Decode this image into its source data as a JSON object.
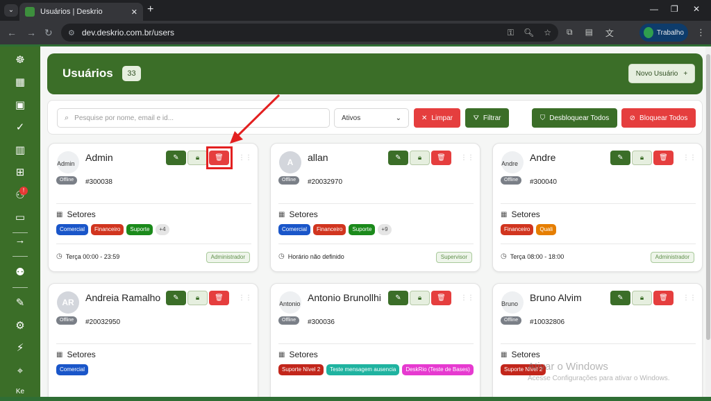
{
  "browser": {
    "tab_title": "Usuários | Deskrio",
    "url": "dev.deskrio.com.br/users",
    "profile_label": "Trabalho"
  },
  "sidebar": {
    "notification_badge": "!",
    "bottom_label": "Ke"
  },
  "header": {
    "title": "Usuários",
    "count": "33",
    "new_user_label": "Novo Usuário"
  },
  "filters": {
    "search_placeholder": "Pesquise por nome, email e id...",
    "status_value": "Ativos",
    "clear_label": "Limpar",
    "filter_label": "Filtrar",
    "unlock_all_label": "Desbloquear Todos",
    "lock_all_label": "Bloquear Todos"
  },
  "labels": {
    "offline": "Offline",
    "setores": "Setores"
  },
  "colors": {
    "primary_green": "#3b6e28",
    "danger_red": "#e53e3e",
    "comercial": "#1a56c9",
    "financeiro": "#d1351f",
    "suporte": "#1b8a1b",
    "quali": "#e67e00",
    "suporte_nivel2": "#c2261b",
    "teste_msg": "#1fb3a0",
    "deskrio_bases": "#e63ad0"
  },
  "cards": [
    {
      "name": "Admin",
      "avatar": "Admin",
      "avatar_type": "image",
      "id": "#300038",
      "tags": [
        {
          "label": "Comercial",
          "color": "#1a56c9"
        },
        {
          "label": "Financeiro",
          "color": "#d1351f"
        },
        {
          "label": "Suporte",
          "color": "#1b8a1b"
        }
      ],
      "more": "+4",
      "schedule": "Terça 00:00 - 23:59",
      "role": "Administrador"
    },
    {
      "name": "allan",
      "avatar": "A",
      "avatar_type": "initials",
      "id": "#20032970",
      "tags": [
        {
          "label": "Comercial",
          "color": "#1a56c9"
        },
        {
          "label": "Financeiro",
          "color": "#d1351f"
        },
        {
          "label": "Suporte",
          "color": "#1b8a1b"
        }
      ],
      "more": "+9",
      "schedule": "Horário não definido",
      "role": "Supervisor"
    },
    {
      "name": "Andre",
      "avatar": "Andre",
      "avatar_type": "image",
      "id": "#300040",
      "tags": [
        {
          "label": "Financeiro",
          "color": "#d1351f"
        },
        {
          "label": "Quali",
          "color": "#e67e00"
        }
      ],
      "more": "",
      "schedule": "Terça 08:00 - 18:00",
      "role": "Administrador"
    },
    {
      "name": "Andreia Ramalho",
      "avatar": "AR",
      "avatar_type": "initials",
      "id": "#20032950",
      "tags": [
        {
          "label": "Comercial",
          "color": "#1a56c9"
        }
      ],
      "more": "",
      "schedule": "",
      "role": ""
    },
    {
      "name": "Antonio Brunollhi",
      "avatar": "Antonio",
      "avatar_type": "image",
      "id": "#300036",
      "tags": [
        {
          "label": "Suporte Nível 2",
          "color": "#c2261b"
        },
        {
          "label": "Teste mensagem ausencia",
          "color": "#1fb3a0"
        },
        {
          "label": "DeskRio (Teste de Bases)",
          "color": "#e63ad0"
        }
      ],
      "more": "",
      "schedule": "",
      "role": ""
    },
    {
      "name": "Bruno Alvim",
      "avatar": "Bruno",
      "avatar_type": "image",
      "id": "#10032806",
      "tags": [
        {
          "label": "Suporte Nível 2",
          "color": "#c2261b"
        }
      ],
      "more": "",
      "schedule": "",
      "role": ""
    }
  ],
  "watermark": {
    "title": "Ativar o Windows",
    "subtitle": "Acesse Configurações para ativar o Windows."
  }
}
